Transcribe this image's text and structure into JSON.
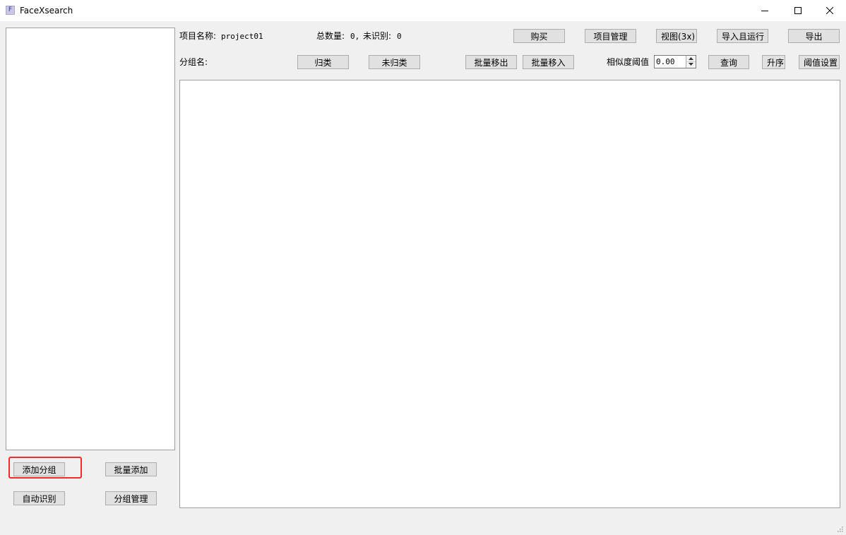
{
  "window": {
    "title": "FaceXsearch",
    "icon_letter": "F",
    "controls": [
      "minimize-icon",
      "maximize-icon",
      "close-icon"
    ]
  },
  "info": {
    "project_label": "项目名称:",
    "project_value": "project01",
    "total_label": "总数量:",
    "total_value": "0,",
    "unrecognized_label": "未识别:",
    "unrecognized_value": "0",
    "group_name_label": "分组名:"
  },
  "toolbar": {
    "buy": "购买",
    "project_manage": "项目管理",
    "view": "视图(3x)",
    "import_run": "导入且运行",
    "export": "导出",
    "classify": "归类",
    "unclassified": "未归类",
    "batch_move_out": "批量移出",
    "batch_move_in": "批量移入",
    "similarity_label": "相似度阈值",
    "similarity_value": "0.00",
    "query": "查询",
    "ascending": "升序",
    "threshold_settings": "阈值设置"
  },
  "left_actions": {
    "add_group": "添加分组",
    "batch_add": "批量添加",
    "auto_recognize": "自动识别",
    "group_manage": "分组管理"
  },
  "colors": {
    "highlight": "#f22b2b",
    "window_bg": "#f0f0f0",
    "button_bg": "#e1e1e1"
  }
}
